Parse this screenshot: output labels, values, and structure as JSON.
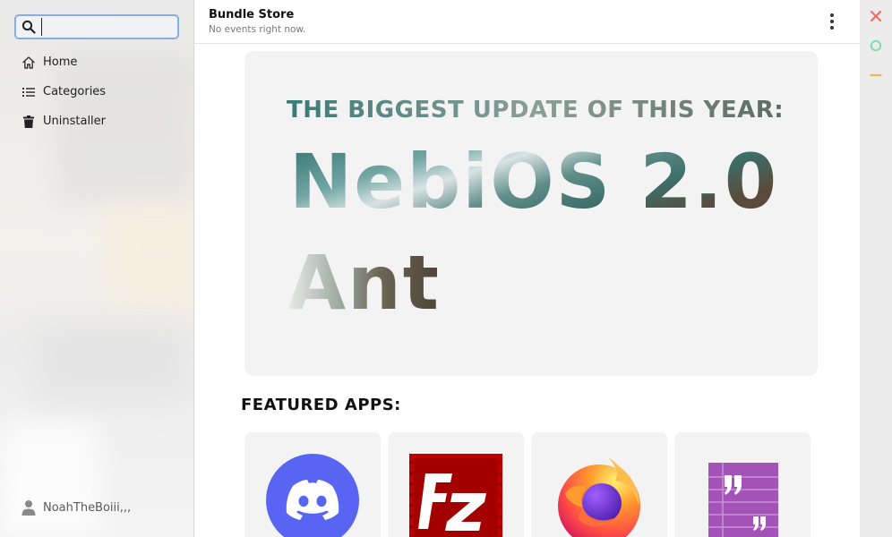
{
  "search": {
    "value": "",
    "placeholder": ""
  },
  "sidebar": {
    "items": [
      {
        "label": "Home",
        "icon": "home-icon"
      },
      {
        "label": "Categories",
        "icon": "list-icon"
      },
      {
        "label": "Uninstaller",
        "icon": "trash-icon"
      }
    ],
    "user": {
      "name": "NoahTheBoiii,,,",
      "icon": "user-icon"
    }
  },
  "header": {
    "title": "Bundle Store",
    "subtitle": "No events right now.",
    "menu_icon": "kebab-menu-icon"
  },
  "banner": {
    "line1": "THE BIGGEST UPDATE OF THIS YEAR:",
    "line2": "NebiOS 2.0",
    "line3": "Ant"
  },
  "featured": {
    "heading": "FEATURED APPS:",
    "apps": [
      {
        "icon": "discord-icon",
        "color": "#5865f2"
      },
      {
        "icon": "filezilla-icon",
        "color": "#bf0000"
      },
      {
        "icon": "firefox-icon",
        "color": "#ff7139"
      },
      {
        "icon": "notes-quote-icon",
        "color": "#a352b8"
      }
    ]
  },
  "window_controls": {
    "close": {
      "icon": "close-icon",
      "color": "#f26b6b"
    },
    "maximize": {
      "icon": "circle-icon",
      "color": "#7ddcb0"
    },
    "minimize": {
      "icon": "minus-icon",
      "color": "#f5b54a"
    }
  }
}
